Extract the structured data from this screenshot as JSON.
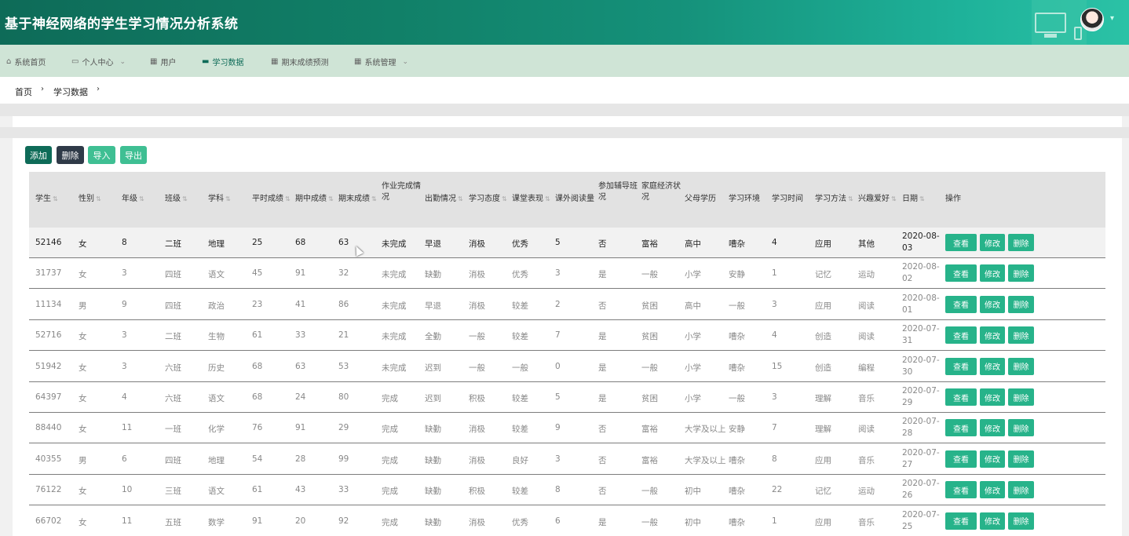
{
  "header": {
    "title": "基于神经网络的学生学习情况分析系统"
  },
  "nav": [
    {
      "label": "系统首页",
      "icon": "home-icon"
    },
    {
      "label": "个人中心",
      "icon": "calendar-icon",
      "dropdown": true
    },
    {
      "label": "用户",
      "icon": "grid-icon"
    },
    {
      "label": "学习数据",
      "icon": "chat-icon",
      "active": true
    },
    {
      "label": "期末成绩预测",
      "icon": "grid-icon"
    },
    {
      "label": "系统管理",
      "icon": "grid-icon",
      "dropdown": true
    }
  ],
  "breadcrumb": {
    "home": "首页",
    "current": "学习数据"
  },
  "toolbar": {
    "add": "添加",
    "delete": "删除",
    "import": "导入",
    "export": "导出"
  },
  "table": {
    "headers": {
      "student": "学生",
      "gender": "性别",
      "grade": "年级",
      "class": "班级",
      "subject": "学科",
      "usual": "平时成绩",
      "mid": "期中成绩",
      "final": "期末成绩",
      "homework_a": "作业完成情",
      "homework_b": "况",
      "attendance": "出勤情况",
      "attitude": "学习态度",
      "classperf": "课堂表现",
      "reading": "课外阅读量",
      "tutor_a": "参加辅导班",
      "tutor_b": "况",
      "family_a": "家庭经济状",
      "family_b": "况",
      "parentedu": "父母学历",
      "env": "学习环境",
      "time": "学习时间",
      "method": "学习方法",
      "hobby": "兴趣爱好",
      "date": "日期",
      "ops": "操作"
    },
    "row_buttons": {
      "view": "查看",
      "edit": "修改",
      "delete": "删除"
    },
    "rows": [
      {
        "student": "52146",
        "gender": "女",
        "grade": "8",
        "class": "二班",
        "subject": "地理",
        "usual": "25",
        "mid": "68",
        "final": "63",
        "homework": "未完成",
        "attendance": "早退",
        "attitude": "消极",
        "classperf": "优秀",
        "reading": "5",
        "tutor": "否",
        "family": "富裕",
        "parentedu": "高中",
        "env": "嘈杂",
        "time": "4",
        "method": "应用",
        "hobby": "其他",
        "date": "2020-08-03"
      },
      {
        "student": "31737",
        "gender": "女",
        "grade": "3",
        "class": "四班",
        "subject": "语文",
        "usual": "45",
        "mid": "91",
        "final": "32",
        "homework": "未完成",
        "attendance": "缺勤",
        "attitude": "消极",
        "classperf": "优秀",
        "reading": "3",
        "tutor": "是",
        "family": "一般",
        "parentedu": "小学",
        "env": "安静",
        "time": "1",
        "method": "记忆",
        "hobby": "运动",
        "date": "2020-08-02"
      },
      {
        "student": "11134",
        "gender": "男",
        "grade": "9",
        "class": "四班",
        "subject": "政治",
        "usual": "23",
        "mid": "41",
        "final": "86",
        "homework": "未完成",
        "attendance": "早退",
        "attitude": "消极",
        "classperf": "较差",
        "reading": "2",
        "tutor": "否",
        "family": "贫困",
        "parentedu": "高中",
        "env": "一般",
        "time": "3",
        "method": "应用",
        "hobby": "阅读",
        "date": "2020-08-01"
      },
      {
        "student": "52716",
        "gender": "女",
        "grade": "3",
        "class": "二班",
        "subject": "生物",
        "usual": "61",
        "mid": "33",
        "final": "21",
        "homework": "未完成",
        "attendance": "全勤",
        "attitude": "一般",
        "classperf": "较差",
        "reading": "7",
        "tutor": "是",
        "family": "贫困",
        "parentedu": "小学",
        "env": "嘈杂",
        "time": "4",
        "method": "创造",
        "hobby": "阅读",
        "date": "2020-07-31"
      },
      {
        "student": "51942",
        "gender": "女",
        "grade": "3",
        "class": "六班",
        "subject": "历史",
        "usual": "68",
        "mid": "63",
        "final": "53",
        "homework": "未完成",
        "attendance": "迟到",
        "attitude": "一般",
        "classperf": "一般",
        "reading": "0",
        "tutor": "是",
        "family": "一般",
        "parentedu": "小学",
        "env": "嘈杂",
        "time": "15",
        "method": "创造",
        "hobby": "编程",
        "date": "2020-07-30"
      },
      {
        "student": "64397",
        "gender": "女",
        "grade": "4",
        "class": "六班",
        "subject": "语文",
        "usual": "68",
        "mid": "24",
        "final": "80",
        "homework": "完成",
        "attendance": "迟到",
        "attitude": "积极",
        "classperf": "较差",
        "reading": "5",
        "tutor": "是",
        "family": "贫困",
        "parentedu": "小学",
        "env": "一般",
        "time": "3",
        "method": "理解",
        "hobby": "音乐",
        "date": "2020-07-29"
      },
      {
        "student": "88440",
        "gender": "女",
        "grade": "11",
        "class": "一班",
        "subject": "化学",
        "usual": "76",
        "mid": "91",
        "final": "29",
        "homework": "完成",
        "attendance": "缺勤",
        "attitude": "消极",
        "classperf": "较差",
        "reading": "9",
        "tutor": "否",
        "family": "富裕",
        "parentedu": "大学及以上",
        "env": "安静",
        "time": "7",
        "method": "理解",
        "hobby": "阅读",
        "date": "2020-07-28"
      },
      {
        "student": "40355",
        "gender": "男",
        "grade": "6",
        "class": "四班",
        "subject": "地理",
        "usual": "54",
        "mid": "28",
        "final": "99",
        "homework": "完成",
        "attendance": "缺勤",
        "attitude": "消极",
        "classperf": "良好",
        "reading": "3",
        "tutor": "否",
        "family": "富裕",
        "parentedu": "大学及以上",
        "env": "嘈杂",
        "time": "8",
        "method": "应用",
        "hobby": "音乐",
        "date": "2020-07-27"
      },
      {
        "student": "76122",
        "gender": "女",
        "grade": "10",
        "class": "三班",
        "subject": "语文",
        "usual": "61",
        "mid": "43",
        "final": "33",
        "homework": "完成",
        "attendance": "缺勤",
        "attitude": "积极",
        "classperf": "较差",
        "reading": "8",
        "tutor": "否",
        "family": "一般",
        "parentedu": "初中",
        "env": "嘈杂",
        "time": "22",
        "method": "记忆",
        "hobby": "运动",
        "date": "2020-07-26"
      },
      {
        "student": "66702",
        "gender": "女",
        "grade": "11",
        "class": "五班",
        "subject": "数学",
        "usual": "91",
        "mid": "20",
        "final": "92",
        "homework": "完成",
        "attendance": "缺勤",
        "attitude": "消极",
        "classperf": "优秀",
        "reading": "6",
        "tutor": "是",
        "family": "一般",
        "parentedu": "初中",
        "env": "嘈杂",
        "time": "1",
        "method": "应用",
        "hobby": "音乐",
        "date": "2020-07-25"
      }
    ]
  },
  "colors": {
    "primary": "#0e6b58",
    "nav_bg": "#cfe4d6",
    "row_button": "#27b38a",
    "delete_button": "#2f3a48",
    "light_button": "#3fbf93"
  }
}
